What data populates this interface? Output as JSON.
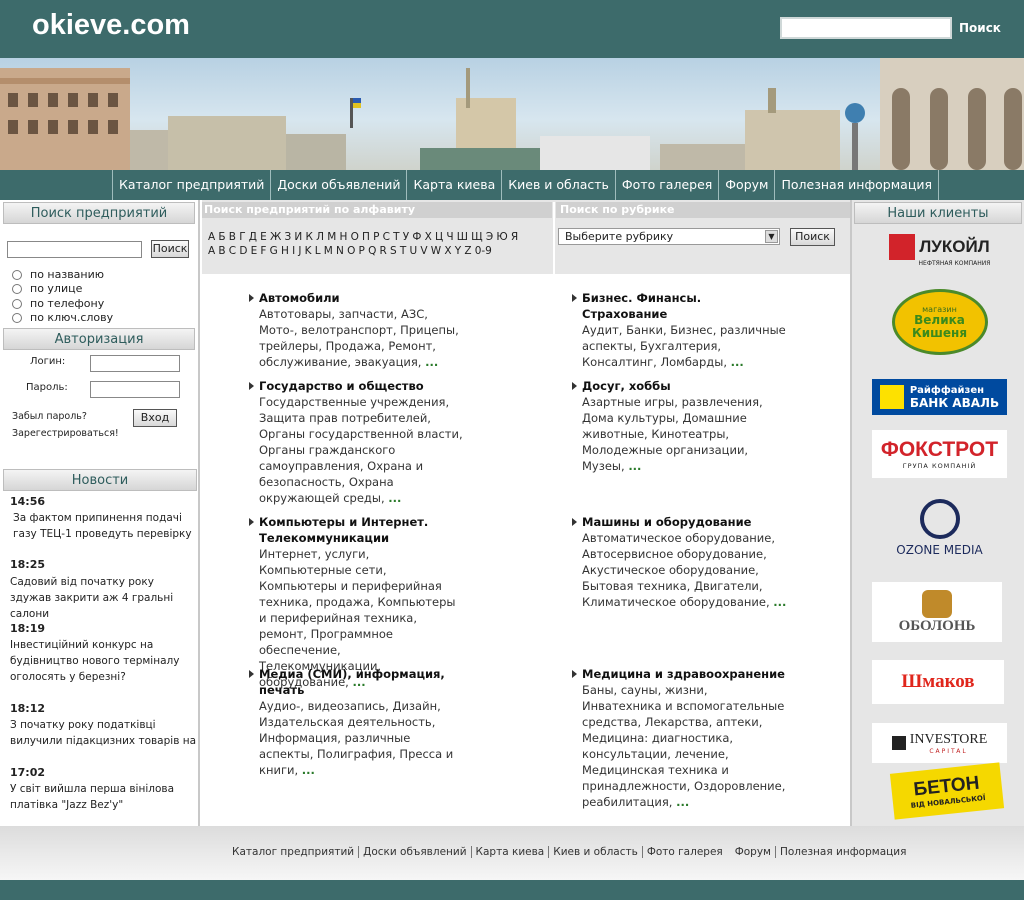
{
  "header": {
    "logo": "okieve.com",
    "search_button": "Поиск"
  },
  "nav": [
    "Каталог предприятий",
    "Доски объявлений",
    "Карта киева",
    "Киев и область",
    "Фото галерея",
    "Форум",
    "Полезная информация"
  ],
  "left": {
    "search": {
      "title": "Поиск предприятий",
      "button": "Поиск",
      "options": [
        "по названию",
        "по улице",
        "по телефону",
        "по ключ.слову"
      ]
    },
    "auth": {
      "title": "Авторизация",
      "login_label": "Логин:",
      "password_label": "Пароль:",
      "forgot": "Забыл пароль?",
      "register": "Зарегестрироваться!",
      "submit": "Вход"
    },
    "news": {
      "title": "Новости",
      "items": [
        {
          "time": "14:56",
          "text": "За фактом припинення подачі газу ТЕЦ-1 проведуть перевірку"
        },
        {
          "time": "18:25",
          "text": "Садовий від початку року здужав закрити аж 4 гральні салони"
        },
        {
          "time": "18:19",
          "text": "Інвестиційний конкурс на будівництво нового терміналу оголосять у березні?"
        },
        {
          "time": "18:12",
          "text": "З початку року податківці вилучили підакцизних товарів на"
        },
        {
          "time": "17:02",
          "text": "У світ вийшла перша вінілова платівка \"Jazz Bez'y\""
        }
      ]
    }
  },
  "center": {
    "alpha_title": "Поиск предприятий по алфавиту",
    "cyr_letters": [
      "А",
      "Б",
      "В",
      "Г",
      "Д",
      "Е",
      "Ж",
      "З",
      "И",
      "К",
      "Л",
      "М",
      "Н",
      "О",
      "П",
      "Р",
      "С",
      "Т",
      "У",
      "Ф",
      "Х",
      "Ц",
      "Ч",
      "Ш",
      "Щ",
      "Э",
      "Ю",
      "Я"
    ],
    "lat_letters": [
      "A",
      "B",
      "C",
      "D",
      "E",
      "F",
      "G",
      "H",
      "I",
      "J",
      "K",
      "L",
      "M",
      "N",
      "O",
      "P",
      "Q",
      "R",
      "S",
      "T",
      "U",
      "V",
      "W",
      "X",
      "Y",
      "Z",
      "0-9"
    ],
    "rubric_title": "Поиск по рубрике",
    "rubric_select": "Выберите рубрику",
    "rubric_button": "Поиск",
    "categories": [
      {
        "title": "Автомобили",
        "desc": "Автотовары, запчасти, АЗС, Мото-, велотранспорт, Прицепы, трейлеры, Продажа, Ремонт, обслуживание, эвакуация,"
      },
      {
        "title": "Бизнес.  Финансы. Страхование",
        "desc": "Аудит, Банки, Бизнес, различные аспекты, Бухгалтерия, Консалтинг, Ломбарды,"
      },
      {
        "title": "Государство и общество",
        "desc": "Государственные учреждения, Защита прав потребителей, Органы государственной власти, Органы гражданского самоуправления, Охрана и безопасность, Охрана окружающей среды,"
      },
      {
        "title": "Досуг, хоббы",
        "desc": "Азартные игры, развлечения, Дома культуры, Домашние животные, Кинотеатры, Молодежные организации, Музеы,"
      },
      {
        "title": "Компьютеры и Интернет. Телекоммуникации",
        "desc": "Интернет, услуги, Компьютерные сети, Компьютеры и периферийная техника, продажа, Компьютеры и периферийная техника, ремонт, Программное обеспечение, Телекоммуникации, оборудование,"
      },
      {
        "title": "Машины и оборудование",
        "desc": "Автоматическое оборудование, Автосервисное оборудование, Акустическое оборудование, Бытовая техника, Двигатели, Климатическое оборудование,"
      },
      {
        "title": "Медиа (СМИ), информация, печать",
        "desc": "Аудио-, видеозапись, Дизайн, Издательская деятельность, Информация, различные аспекты, Полиграфия, Пресса и книги,"
      },
      {
        "title": "Медицина и здравоохранение",
        "desc": "Баны, сауны, жизни, Инватехника и вспомогательные средства, Лекарства, аптеки, Медицина: диагностика, консультации, лечение, Медицинская техника и принадлежности, Оздоровление, реабилитация,"
      }
    ],
    "more": "..."
  },
  "right": {
    "title": "Наши клиенты",
    "clients": [
      {
        "name": "ЛУКОЙЛ",
        "sub": "НЕФТЯНАЯ КОМПАНИЯ"
      },
      {
        "name": "Велика Кишеня",
        "sub": "магазин"
      },
      {
        "name": "Райффайзен",
        "sub": "БАНК АВАЛЬ"
      },
      {
        "name": "ФОКСТРОТ",
        "sub": "ГРУПА КОМПАНІЙ"
      },
      {
        "name": "OZONE MEDIA",
        "sub": ""
      },
      {
        "name": "ОБОЛОНЬ",
        "sub": ""
      },
      {
        "name": "Шмаков",
        "sub": ""
      },
      {
        "name": "INVESTORE",
        "sub": "CAPITAL"
      },
      {
        "name": "БЕТОН",
        "sub": "ВІД НОВАЛЬСЬКОЇ"
      }
    ]
  },
  "footer": [
    "Каталог предприятий",
    "Доски объявлений",
    "Карта киева",
    "Киев и область",
    "Фото галерея",
    "Форум",
    "Полезная информация"
  ]
}
